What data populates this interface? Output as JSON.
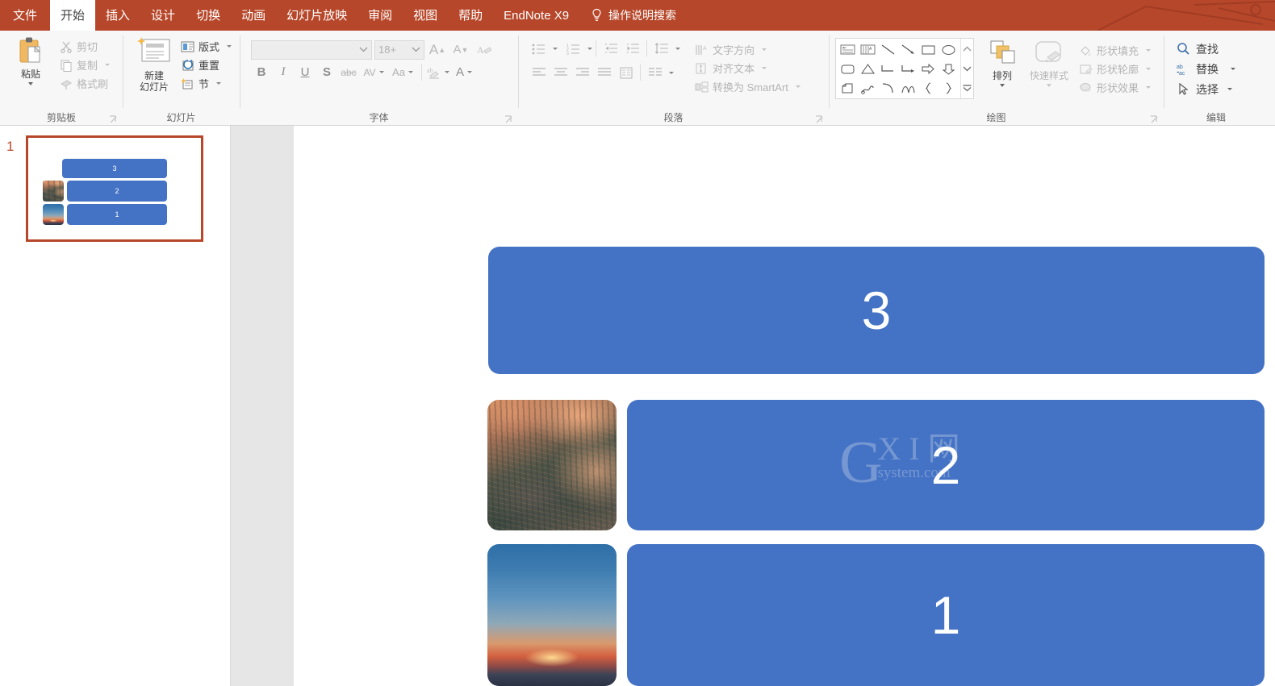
{
  "tabs": [
    {
      "label": "文件",
      "name": "tab-file",
      "style": "file"
    },
    {
      "label": "开始",
      "name": "tab-home",
      "style": "active"
    },
    {
      "label": "插入",
      "name": "tab-insert",
      "style": ""
    },
    {
      "label": "设计",
      "name": "tab-design",
      "style": ""
    },
    {
      "label": "切换",
      "name": "tab-transitions",
      "style": ""
    },
    {
      "label": "动画",
      "name": "tab-animations",
      "style": ""
    },
    {
      "label": "幻灯片放映",
      "name": "tab-slideshow",
      "style": ""
    },
    {
      "label": "审阅",
      "name": "tab-review",
      "style": ""
    },
    {
      "label": "视图",
      "name": "tab-view",
      "style": ""
    },
    {
      "label": "帮助",
      "name": "tab-help",
      "style": ""
    },
    {
      "label": "EndNote X9",
      "name": "tab-endnote",
      "style": ""
    }
  ],
  "tell_me": {
    "label": "操作说明搜索",
    "icon": "lightbulb-icon"
  },
  "ribbon": {
    "clipboard": {
      "group_label": "剪贴板",
      "paste_label": "粘贴",
      "cut_label": "剪切",
      "copy_label": "复制",
      "format_painter_label": "格式刷"
    },
    "slides": {
      "group_label": "幻灯片",
      "new_slide_label": "新建\n幻灯片",
      "new_slide_line1": "新建",
      "new_slide_line2": "幻灯片",
      "layout_label": "版式",
      "reset_label": "重置",
      "section_label": "节"
    },
    "font": {
      "group_label": "字体",
      "font_name_value": "",
      "font_size_value": "18+",
      "grow_font": "A",
      "shrink_font": "A",
      "clear_formatting": "clear-formatting-icon",
      "bold": "B",
      "italic": "I",
      "underline": "U",
      "shadow": "S",
      "strikethrough": "abc",
      "char_spacing": "AV",
      "change_case": "Aa",
      "text_highlight": "text-highlight-icon",
      "font_color": "A"
    },
    "paragraph": {
      "group_label": "段落",
      "text_direction_label": "文字方向",
      "align_text_label": "对齐文本",
      "smartart_label": "转换为 SmartArt"
    },
    "drawing": {
      "group_label": "绘图",
      "arrange_label": "排列",
      "quick_styles_label": "快速样式",
      "shape_fill_label": "形状填充",
      "shape_outline_label": "形状轮廓",
      "shape_effects_label": "形状效果",
      "shapes": [
        "textbox-icon",
        "vertical-textbox-icon",
        "line-icon",
        "arrow-icon",
        "rectangle-icon",
        "oval-icon",
        "rounded-rectangle-icon",
        "triangle-icon",
        "elbow-connector-icon",
        "elbow-arrow-connector-icon",
        "right-arrow-icon",
        "down-arrow-icon",
        "freeform-icon",
        "scribble-icon",
        "curve-icon",
        "arc-icon",
        "left-brace-icon",
        "right-brace-icon"
      ]
    },
    "editing": {
      "group_label": "编辑",
      "find_label": "查找",
      "replace_label": "替换",
      "select_label": "选择"
    }
  },
  "thumbnails": [
    {
      "number": "1",
      "selected": true,
      "shapes": [
        {
          "type": "bar",
          "text": "3"
        },
        {
          "type": "image",
          "photo": "forest"
        },
        {
          "type": "bar",
          "text": "2"
        },
        {
          "type": "image",
          "photo": "sunset"
        },
        {
          "type": "bar",
          "text": "1"
        }
      ]
    }
  ],
  "slide": {
    "blocks": [
      {
        "number": "3",
        "has_image": false,
        "image": ""
      },
      {
        "number": "2",
        "has_image": true,
        "image": "forest"
      },
      {
        "number": "1",
        "has_image": true,
        "image": "sunset"
      }
    ],
    "accent_color": "#4472C4",
    "text_color": "#FFFFFF"
  },
  "watermark": {
    "brand": "G",
    "mid": "X I 网",
    "sub": "system.com"
  }
}
